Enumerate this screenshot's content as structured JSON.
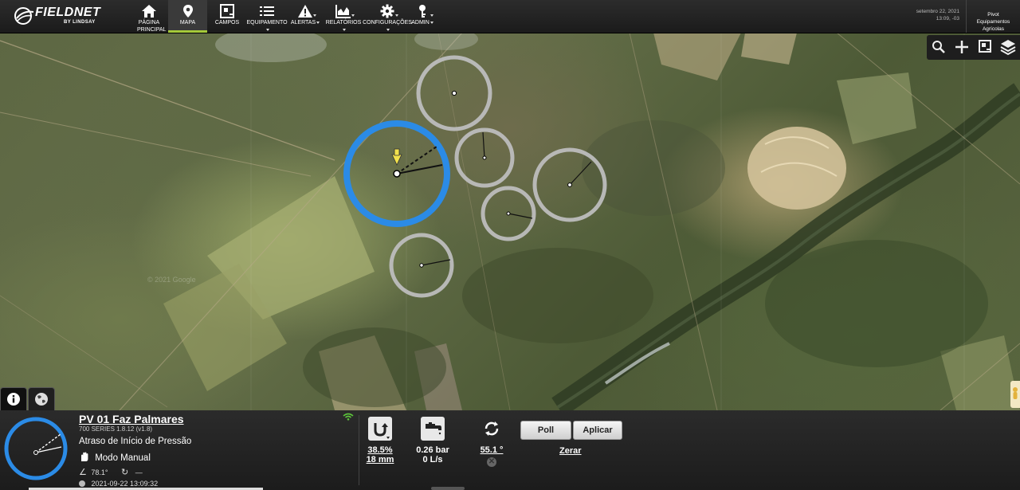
{
  "app": {
    "brand": "FIELDNET",
    "brand_sub": "BY LINDSAY"
  },
  "nav": {
    "items": [
      {
        "label": "PÁGINA PRINCIPAL",
        "icon": "home-icon",
        "active": false,
        "dropdown": false
      },
      {
        "label": "MAPA",
        "icon": "map-pin-icon",
        "active": true,
        "dropdown": false
      },
      {
        "label": "CAMPOS",
        "icon": "fields-icon",
        "active": false,
        "dropdown": false
      },
      {
        "label": "EQUIPAMENTO",
        "icon": "equipment-list-icon",
        "active": false,
        "dropdown": true
      },
      {
        "label": "ALERTAS",
        "icon": "alert-icon",
        "active": false,
        "dropdown": true
      },
      {
        "label": "RELATÓRIOS",
        "icon": "reports-chart-icon",
        "active": false,
        "dropdown": true
      },
      {
        "label": "CONFIGURAÇÕES",
        "icon": "gear-icon",
        "active": false,
        "dropdown": true
      },
      {
        "label": "ADMIN",
        "icon": "key-icon",
        "active": false,
        "dropdown": true
      }
    ],
    "date": "setembro 22, 2021",
    "time": "13:09, -03",
    "user_line1": "Pivot",
    "user_line2": "Equipamentos",
    "user_line3": "Agrícolas"
  },
  "map": {
    "watermark": "© 2021 Google",
    "controls": [
      "zoom-out-icon",
      "zoom-in-icon",
      "draw-field-icon",
      "layers-icon"
    ],
    "side_tabs": [
      "info-icon",
      "globe-icon"
    ]
  },
  "panel": {
    "title": "PV 01 Faz Palmares",
    "series": "700 SERIES 1.8.12 (v1.8)",
    "status": "Atraso de Início de Pressão",
    "mode": "Modo Manual",
    "angle": "78.1°",
    "direction_value": "—",
    "timestamp": "2021-09-22 13:09:32",
    "depth_percent": "38.5%",
    "depth_mm": "18 mm",
    "pressure": "0.26 bar",
    "flow": "0 L/s",
    "position": "55.1 °",
    "poll_label": "Poll",
    "apply_label": "Aplicar",
    "reset_label": "Zerar",
    "colors": {
      "accent": "#2b8be6",
      "nav_active": "#a5c93a",
      "signal": "#5cc33b"
    }
  }
}
